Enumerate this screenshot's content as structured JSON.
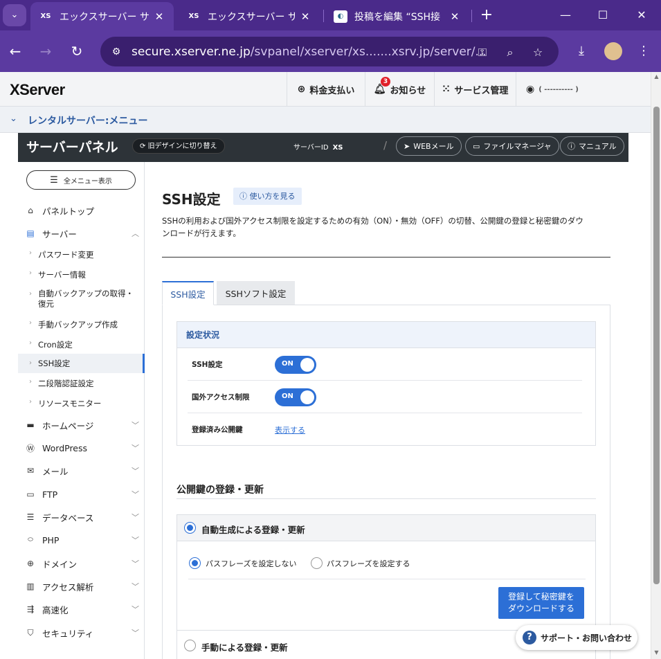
{
  "browser": {
    "tabs": [
      {
        "favicon": "XS",
        "title": "エックスサーバー サーバ",
        "active": true
      },
      {
        "favicon": "XS",
        "title": "エックスサーバー サーバ",
        "active": false
      },
      {
        "favicon": "wp",
        "title": "投稿を編集 “SSH接",
        "active": false
      }
    ],
    "url_host": "secure.xserver.ne.jp",
    "url_path": "/svpanel/xserver/xs.......xsrv.jp/server/..."
  },
  "header": {
    "logo": "XServer",
    "payment": "料金支払い",
    "notice": "お知らせ",
    "notice_count": "3",
    "service": "サービス管理",
    "account": "( ---------- )"
  },
  "breadcrumb": {
    "label": "レンタルサーバー:メニュー"
  },
  "panel": {
    "title": "サーバーパネル",
    "old_design": "旧デザインに切り替え",
    "server_id_label": "サーバーID",
    "server_id_value": "XS",
    "webmail": "WEBメール",
    "file_manager": "ファイルマネージャ",
    "manual": "マニュアル"
  },
  "sidebar": {
    "all_menu": "全メニュー表示",
    "top": "パネルトップ",
    "server": "サーバー",
    "sub_items": [
      "パスワード変更",
      "サーバー情報",
      "自動バックアップの取得・",
      "復元",
      "手動バックアップ作成",
      "Cron設定",
      "SSH設定",
      "二段階認証設定",
      "リソースモニター"
    ],
    "sections": [
      "ホームページ",
      "WordPress",
      "メール",
      "FTP",
      "データベース",
      "PHP",
      "ドメイン",
      "アクセス解析",
      "高速化",
      "セキュリティ"
    ]
  },
  "main": {
    "title": "SSH設定",
    "howto": "使い方を見る",
    "desc_line1": "SSHの利用および国外アクセス制限を設定するための有効（ON）・無効（OFF）の切替、公開鍵の登録と秘密鍵のダウ",
    "desc_line2": "ンロードが行えます。",
    "tabs": [
      "SSH設定",
      "SSHソフト設定"
    ],
    "status_heading": "設定状況",
    "rows": [
      {
        "label": "SSH設定",
        "value": "ON"
      },
      {
        "label": "国外アクセス制限",
        "value": "ON"
      },
      {
        "label": "登録済み公開鍵",
        "link": "表示する"
      }
    ],
    "register_heading": "公開鍵の登録・更新",
    "auto_option": "自動生成による登録・更新",
    "pass_no": "パスフレーズを設定しない",
    "pass_yes": "パスフレーズを設定する",
    "download_line1": "登録して秘密鍵を",
    "download_line2": "ダウンロードする",
    "manual_option": "手動による登録・更新"
  },
  "support": "サポート・お問い合わせ",
  "colors": {
    "accent": "#2c6fd6",
    "browser": "#5b3aa0",
    "panel_dark": "#2d3338"
  }
}
